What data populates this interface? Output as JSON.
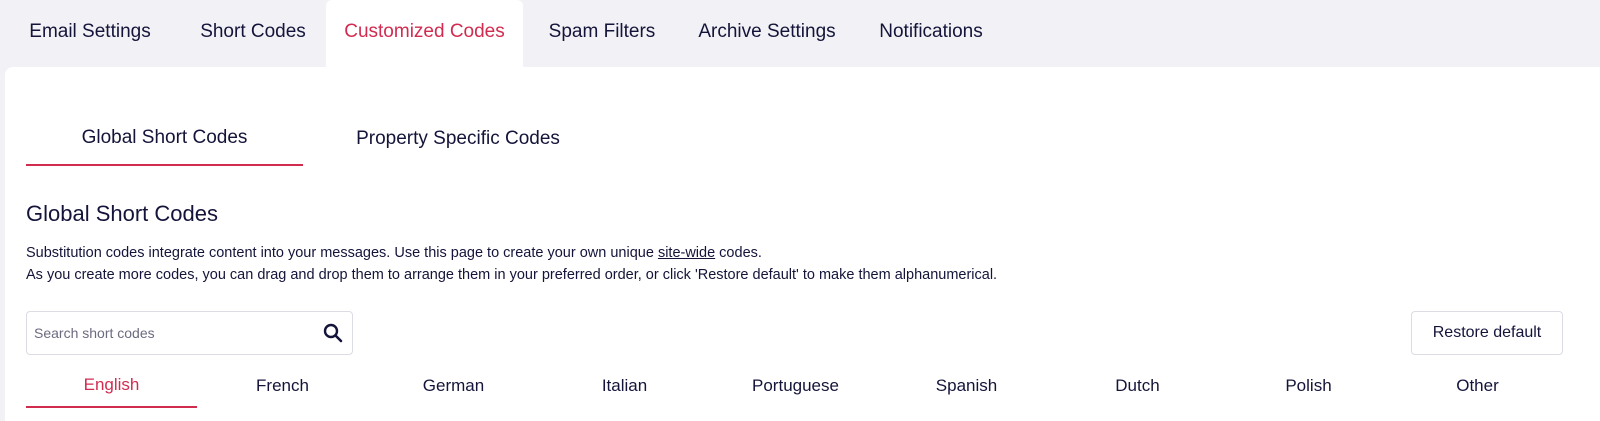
{
  "top_tabs": [
    {
      "label": "Email Settings"
    },
    {
      "label": "Short Codes"
    },
    {
      "label": "Customized Codes",
      "active": true
    },
    {
      "label": "Spam Filters"
    },
    {
      "label": "Archive Settings"
    },
    {
      "label": "Notifications"
    }
  ],
  "sub_tabs": [
    {
      "label": "Global Short Codes",
      "active": true
    },
    {
      "label": "Property Specific Codes"
    }
  ],
  "section": {
    "title": "Global Short Codes",
    "desc_line1_before": "Substitution codes integrate content into your messages. Use this page to create your own unique ",
    "desc_line1_link": "site-wide",
    "desc_line1_after": " codes.",
    "desc_line2": "As you create more codes, you can drag and drop them to arrange them in your preferred order, or click 'Restore default' to make them alphanumerical."
  },
  "search": {
    "placeholder": "Search short codes",
    "value": "",
    "icon": "search-icon"
  },
  "restore_button": {
    "label": "Restore default"
  },
  "language_tabs": [
    {
      "label": "English",
      "active": true
    },
    {
      "label": "French"
    },
    {
      "label": "German"
    },
    {
      "label": "Italian"
    },
    {
      "label": "Portuguese"
    },
    {
      "label": "Spanish"
    },
    {
      "label": "Dutch"
    },
    {
      "label": "Polish"
    },
    {
      "label": "Other"
    }
  ],
  "colors": {
    "accent": "#d22b50",
    "text": "#14143a",
    "background": "#f2f2f6",
    "panel": "#ffffff"
  }
}
